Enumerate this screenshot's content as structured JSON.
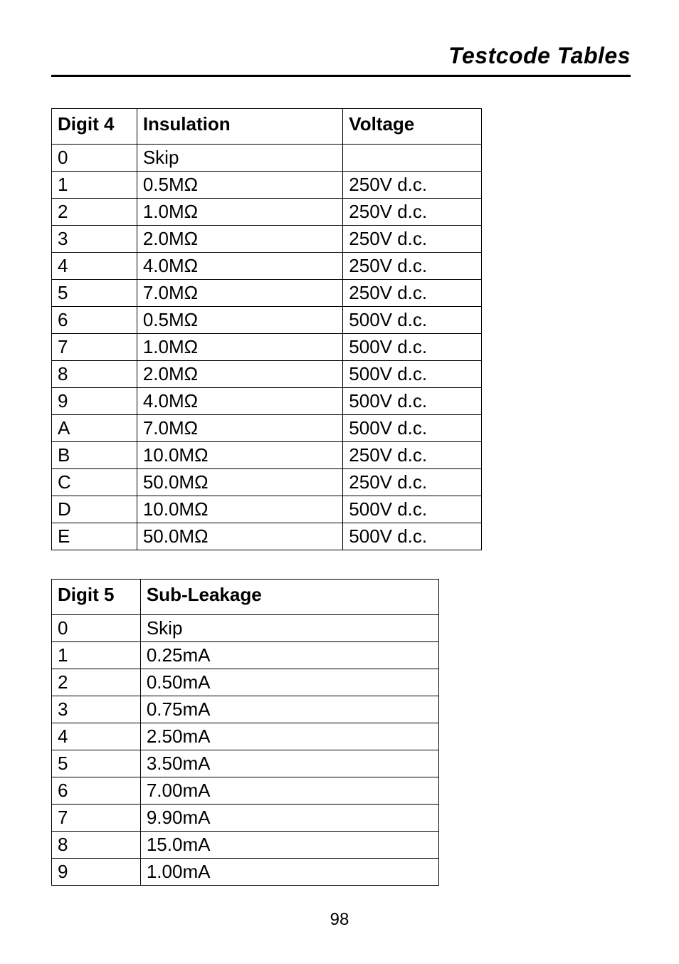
{
  "header": {
    "title": "Testcode Tables"
  },
  "table1": {
    "headers": {
      "col1": "Digit 4",
      "col2": "Insulation",
      "col3": "Voltage"
    },
    "rows": [
      {
        "digit": "0",
        "insulation": "Skip",
        "voltage": ""
      },
      {
        "digit": "1",
        "insulation": "0.5MΩ",
        "voltage": "250V d.c."
      },
      {
        "digit": "2",
        "insulation": "1.0MΩ",
        "voltage": "250V d.c."
      },
      {
        "digit": "3",
        "insulation": "2.0MΩ",
        "voltage": "250V d.c."
      },
      {
        "digit": "4",
        "insulation": "4.0MΩ",
        "voltage": "250V d.c."
      },
      {
        "digit": "5",
        "insulation": "7.0MΩ",
        "voltage": "250V d.c."
      },
      {
        "digit": "6",
        "insulation": "0.5MΩ",
        "voltage": "500V d.c."
      },
      {
        "digit": "7",
        "insulation": "1.0MΩ",
        "voltage": "500V d.c."
      },
      {
        "digit": "8",
        "insulation": "2.0MΩ",
        "voltage": "500V d.c."
      },
      {
        "digit": "9",
        "insulation": "4.0MΩ",
        "voltage": "500V d.c."
      },
      {
        "digit": "A",
        "insulation": "7.0MΩ",
        "voltage": "500V d.c."
      },
      {
        "digit": "B",
        "insulation": "10.0MΩ",
        "voltage": "250V d.c."
      },
      {
        "digit": "C",
        "insulation": "50.0MΩ",
        "voltage": "250V d.c."
      },
      {
        "digit": "D",
        "insulation": "10.0MΩ",
        "voltage": "500V d.c."
      },
      {
        "digit": "E",
        "insulation": "50.0MΩ",
        "voltage": "500V d.c."
      }
    ]
  },
  "table2": {
    "headers": {
      "col1": "Digit 5",
      "col2": "Sub-Leakage"
    },
    "rows": [
      {
        "digit": "0",
        "subleakage": "Skip"
      },
      {
        "digit": "1",
        "subleakage": "0.25mA"
      },
      {
        "digit": "2",
        "subleakage": "0.50mA"
      },
      {
        "digit": "3",
        "subleakage": "0.75mA"
      },
      {
        "digit": "4",
        "subleakage": "2.50mA"
      },
      {
        "digit": "5",
        "subleakage": "3.50mA"
      },
      {
        "digit": "6",
        "subleakage": "7.00mA"
      },
      {
        "digit": "7",
        "subleakage": "9.90mA"
      },
      {
        "digit": "8",
        "subleakage": "15.0mA"
      },
      {
        "digit": "9",
        "subleakage": "1.00mA"
      }
    ]
  },
  "page_number": "98"
}
